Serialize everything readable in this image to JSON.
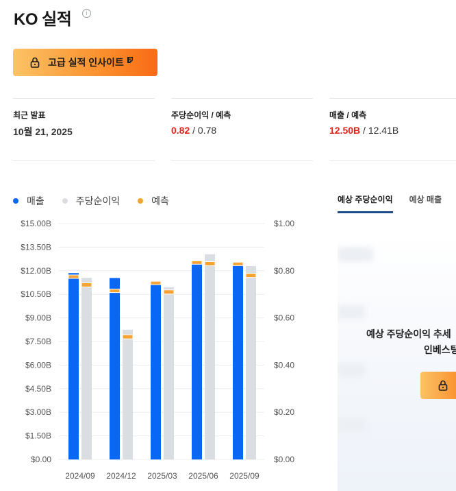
{
  "header": {
    "title": "KO 실적",
    "info_icon": "info-icon"
  },
  "pro_button": {
    "label": "고급 실적 인사이트",
    "icon": "lock-icon",
    "badge_icon": "pro-badge-icon",
    "gradient": [
      "#fbc365",
      "#f96a16"
    ]
  },
  "stats": {
    "latest": {
      "label": "최근 발표",
      "value": "10월 21, 2025"
    },
    "eps": {
      "label": "주당순이익 / 예측",
      "actual": "0.82",
      "sep": " / ",
      "forecast": "0.78"
    },
    "revenue": {
      "label": "매출 / 예측",
      "actual": "12.50B",
      "sep": " / ",
      "forecast": "12.41B"
    }
  },
  "legend": [
    {
      "label": "매출",
      "color": "#0a66f5"
    },
    {
      "label": "주당순이익",
      "color": "#dadde2"
    },
    {
      "label": "예측",
      "color": "#f5a433"
    }
  ],
  "tabs": [
    {
      "label": "예상 주당순이익",
      "active": true
    },
    {
      "label": "예상 매출",
      "active": false
    }
  ],
  "locked_panel": {
    "line1": "예상 주당순이익 추세",
    "line2": "인베스팅",
    "button_icon": "lock-icon"
  },
  "colors": {
    "revenue": "#0a66f5",
    "eps": "#dadde2",
    "forecast": "#f5a433",
    "accent_red": "#e0241b",
    "tab_underline": "#1d4d8a"
  },
  "chart_data": {
    "type": "bar",
    "categories": [
      "2024/09",
      "2024/12",
      "2025/03",
      "2025/06",
      "2025/09"
    ],
    "series": [
      {
        "name": "매출",
        "axis": "left",
        "values": [
          11.85,
          11.54,
          11.13,
          12.54,
          12.5
        ]
      },
      {
        "name": "주당순이익",
        "axis": "right",
        "values": [
          0.77,
          0.55,
          0.73,
          0.87,
          0.82
        ]
      },
      {
        "name": "예측",
        "axis": "left-forecast-revenue",
        "values": [
          11.6,
          10.7,
          11.2,
          12.5,
          12.41
        ]
      },
      {
        "name": "예측",
        "axis": "right-forecast-eps",
        "values": [
          0.74,
          0.52,
          0.71,
          0.83,
          0.78
        ]
      }
    ],
    "y_left": {
      "range": [
        0,
        15
      ],
      "ticks": [
        "$0.00",
        "$1.50B",
        "$3.00B",
        "$4.50B",
        "$6.00B",
        "$7.50B",
        "$9.00B",
        "$10.50B",
        "$12.00B",
        "$13.50B",
        "$15.00B"
      ]
    },
    "y_right": {
      "range": [
        0,
        1
      ],
      "ticks": [
        "$0.00",
        "$0.20",
        "$0.40",
        "$0.60",
        "$0.80",
        "$1.00"
      ]
    },
    "grid": true
  }
}
